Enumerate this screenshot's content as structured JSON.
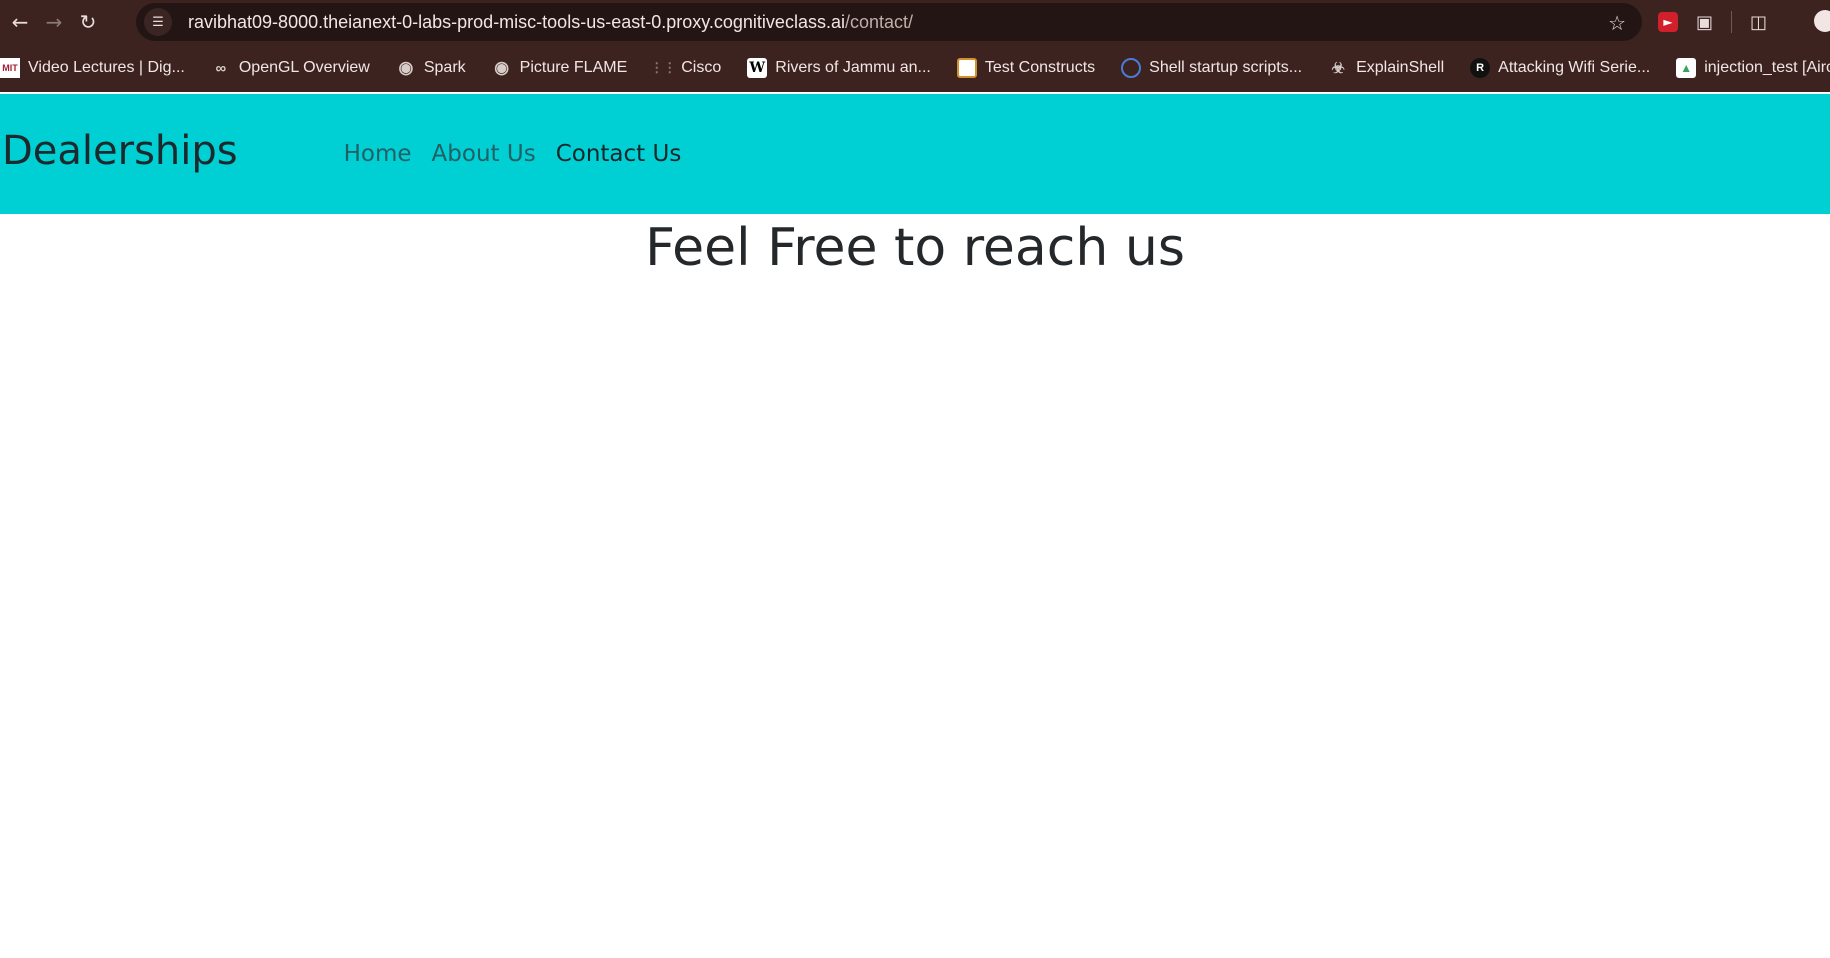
{
  "browser": {
    "url_host": "ravibhat09-8000.theianext-0-labs-prod-misc-tools-us-east-0.proxy.cognitiveclass.ai",
    "url_path": "/contact/",
    "icons": {
      "back": "back-arrow-icon",
      "forward": "forward-arrow-icon",
      "reload": "reload-icon",
      "site_info": "tune-icon",
      "bookmark": "star-icon",
      "extension": "red-extension-icon",
      "extensions_menu": "puzzle-icon",
      "side_panel": "side-panel-icon"
    }
  },
  "bookmarks": [
    {
      "label": "Video Lectures | Dig...",
      "icon": "mit-ocw-icon"
    },
    {
      "label": "OpenGL Overview",
      "icon": "glasses-icon"
    },
    {
      "label": "Spark",
      "icon": "globe-icon"
    },
    {
      "label": "Picture FLAME",
      "icon": "globe-icon"
    },
    {
      "label": "Cisco",
      "icon": "cisco-icon"
    },
    {
      "label": "Rivers of Jammu an...",
      "icon": "wikipedia-icon"
    },
    {
      "label": "Test Constructs",
      "icon": "window-icon"
    },
    {
      "label": "Shell startup scripts...",
      "icon": "circle-icon"
    },
    {
      "label": "ExplainShell",
      "icon": "shell-icon"
    },
    {
      "label": "Attacking Wifi Serie...",
      "icon": "r-logo-icon"
    },
    {
      "label": "injection_test [Aircr...",
      "icon": "image-icon"
    }
  ],
  "site": {
    "brand": "Dealerships",
    "nav": [
      {
        "label": "Home"
      },
      {
        "label": "About Us"
      },
      {
        "label": "Contact Us"
      }
    ],
    "heading": "Feel Free to reach us",
    "colors": {
      "header_bg": "#00cfd4",
      "browser_chrome": "#3c2320"
    }
  }
}
